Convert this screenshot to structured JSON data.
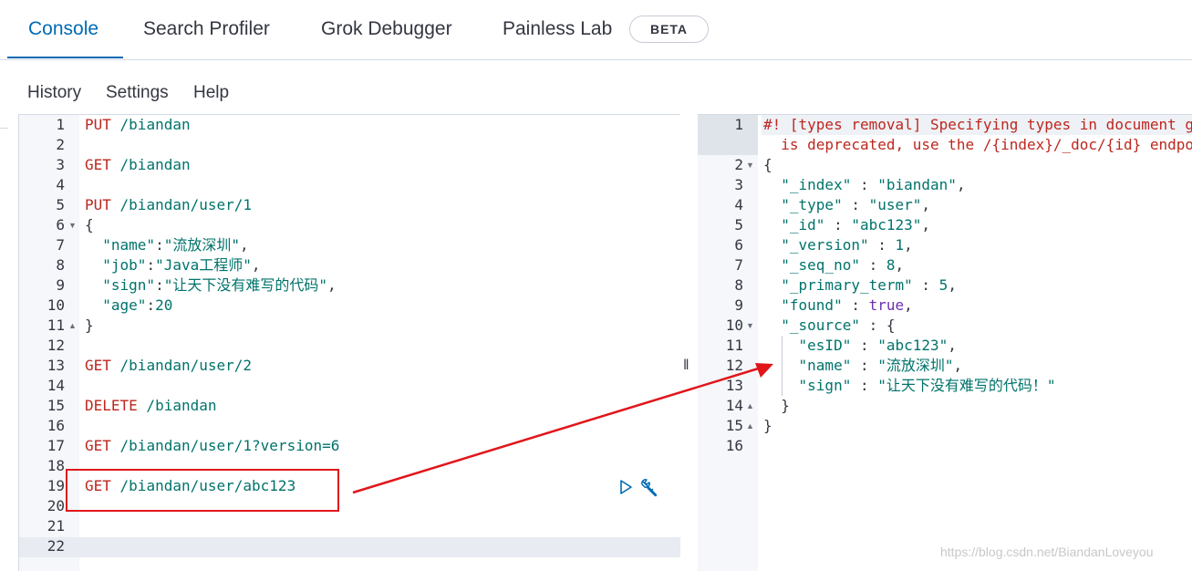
{
  "tabs": [
    {
      "label": "Console",
      "active": true
    },
    {
      "label": "Search Profiler"
    },
    {
      "label": "Grok Debugger"
    },
    {
      "label": "Painless Lab"
    }
  ],
  "beta_badge": "BETA",
  "menu": [
    "History",
    "Settings",
    "Help"
  ],
  "request_lines": [
    {
      "n": "1",
      "method": "PUT",
      "rest": " /biandan"
    },
    {
      "n": "2",
      "text": ""
    },
    {
      "n": "3",
      "method": "GET",
      "rest": " /biandan"
    },
    {
      "n": "4",
      "text": ""
    },
    {
      "n": "5",
      "method": "PUT",
      "rest": " /biandan/user/1"
    },
    {
      "n": "6",
      "text": "{",
      "fold": "▼"
    },
    {
      "n": "7",
      "key": "  \"name\"",
      "sep": ":",
      "val": "\"流放深圳\"",
      "tail": ","
    },
    {
      "n": "8",
      "key": "  \"job\"",
      "sep": ":",
      "val": "\"Java工程师\"",
      "tail": ","
    },
    {
      "n": "9",
      "key": "  \"sign\"",
      "sep": ":",
      "val": "\"让天下没有难写的代码\"",
      "tail": ","
    },
    {
      "n": "10",
      "key": "  \"age\"",
      "sep": ":",
      "num": "20"
    },
    {
      "n": "11",
      "text": "}",
      "fold": "▲"
    },
    {
      "n": "12",
      "text": ""
    },
    {
      "n": "13",
      "method": "GET",
      "rest": " /biandan/user/2"
    },
    {
      "n": "14",
      "text": ""
    },
    {
      "n": "15",
      "method": "DELETE",
      "rest": " /biandan"
    },
    {
      "n": "16",
      "text": ""
    },
    {
      "n": "17",
      "method": "GET",
      "rest": " /biandan/user/1?version=6"
    },
    {
      "n": "18",
      "text": ""
    },
    {
      "n": "19",
      "method": "GET",
      "rest": " /biandan/user/abc123"
    },
    {
      "n": "20",
      "text": ""
    },
    {
      "n": "21",
      "text": ""
    },
    {
      "n": "22",
      "text": ""
    }
  ],
  "response_lines": [
    {
      "n": "1",
      "comment": "#! [types removal] Specifying types in document get requests"
    },
    {
      "n": "",
      "comment": "  is deprecated, use the /{index}/_doc/{id} endpoint instead."
    },
    {
      "n": "2",
      "text": "{",
      "fold": "▼"
    },
    {
      "n": "3",
      "key": "  \"_index\"",
      "sep": " : ",
      "val": "\"biandan\"",
      "tail": ","
    },
    {
      "n": "4",
      "key": "  \"_type\"",
      "sep": " : ",
      "val": "\"user\"",
      "tail": ","
    },
    {
      "n": "5",
      "key": "  \"_id\"",
      "sep": " : ",
      "val": "\"abc123\"",
      "tail": ","
    },
    {
      "n": "6",
      "key": "  \"_version\"",
      "sep": " : ",
      "num": "1",
      "tail": ","
    },
    {
      "n": "7",
      "key": "  \"_seq_no\"",
      "sep": " : ",
      "num": "8",
      "tail": ","
    },
    {
      "n": "8",
      "key": "  \"_primary_term\"",
      "sep": " : ",
      "num": "5",
      "tail": ","
    },
    {
      "n": "9",
      "key": "  \"found\"",
      "sep": " : ",
      "kw": "true",
      "tail": ","
    },
    {
      "n": "10",
      "key": "  \"_source\"",
      "sep": " : ",
      "tail": "{",
      "fold": "▼"
    },
    {
      "n": "11",
      "key": "    \"esID\"",
      "sep": " : ",
      "val": "\"abc123\"",
      "tail": ","
    },
    {
      "n": "12",
      "key": "    \"name\"",
      "sep": " : ",
      "val": "\"流放深圳\"",
      "tail": ","
    },
    {
      "n": "13",
      "key": "    \"sign\"",
      "sep": " : ",
      "val": "\"让天下没有难写的代码！\""
    },
    {
      "n": "14",
      "text": "  }",
      "fold": "▲"
    },
    {
      "n": "15",
      "text": "}",
      "fold": "▲"
    },
    {
      "n": "16",
      "text": ""
    }
  ],
  "icons": {
    "run": "play-icon",
    "settings": "wrench-icon"
  },
  "annotation_color": "#e0161b",
  "watermark": "https://blog.csdn.net/BiandanLoveyou"
}
